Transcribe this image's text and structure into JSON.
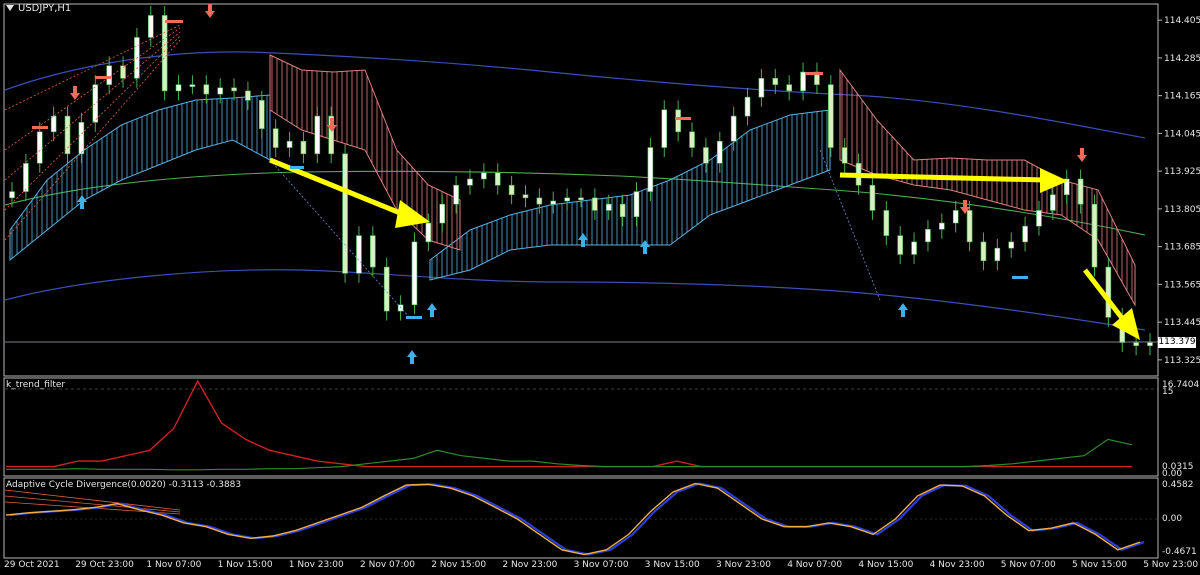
{
  "symbol": "USDJPY,H1",
  "current_price": "113.379",
  "chart_data": {
    "type": "line",
    "main_price_ticks": [
      "114.405",
      "114.285",
      "114.165",
      "114.045",
      "113.925",
      "113.805",
      "113.685",
      "113.565",
      "113.445",
      "113.325"
    ],
    "main_ylim": [
      113.28,
      114.45
    ],
    "time_labels": [
      "29 Oct 2021",
      "29 Oct 23:00",
      "1 Nov 07:00",
      "1 Nov 15:00",
      "1 Nov 23:00",
      "2 Nov 07:00",
      "2 Nov 15:00",
      "2 Nov 23:00",
      "3 Nov 07:00",
      "3 Nov 15:00",
      "3 Nov 23:00",
      "4 Nov 07:00",
      "4 Nov 15:00",
      "4 Nov 23:00",
      "5 Nov 07:00",
      "5 Nov 15:00",
      "5 Nov 23:00"
    ],
    "price_close": [
      113.86,
      113.95,
      114.05,
      114.1,
      113.98,
      114.08,
      114.2,
      114.26,
      114.22,
      114.35,
      114.42,
      114.18,
      114.2,
      114.2,
      114.17,
      114.19,
      114.18,
      114.15,
      114.06,
      114.0,
      114.02,
      113.98,
      114.1,
      113.98,
      113.6,
      113.72,
      113.62,
      113.48,
      113.5,
      113.7,
      113.76,
      113.82,
      113.88,
      113.9,
      113.92,
      113.88,
      113.85,
      113.84,
      113.82,
      113.83,
      113.84,
      113.84,
      113.8,
      113.82,
      113.78,
      113.86,
      114.0,
      114.12,
      114.05,
      114.0,
      113.95,
      114.02,
      114.1,
      114.16,
      114.22,
      114.2,
      114.18,
      114.24,
      114.2,
      114.0,
      113.95,
      113.88,
      113.8,
      113.72,
      113.66,
      113.7,
      113.74,
      113.76,
      113.8,
      113.7,
      113.64,
      113.68,
      113.7,
      113.75,
      113.8,
      113.85,
      113.9,
      113.82,
      113.62,
      113.46,
      113.38,
      113.37,
      113.38
    ],
    "series": [
      {
        "name": "k_trend_filter red",
        "values": [
          1,
          1,
          1,
          2,
          2,
          3,
          4,
          8,
          16.74,
          9,
          6,
          4,
          3,
          2,
          1.5,
          1,
          1,
          1,
          1,
          1,
          1,
          1,
          1,
          1,
          1,
          1,
          1,
          1,
          2,
          1,
          1,
          1,
          1,
          1,
          1,
          1,
          1,
          1,
          1,
          1,
          1,
          1,
          1,
          1,
          1,
          1,
          1,
          1
        ]
      },
      {
        "name": "k_trend_filter green",
        "values": [
          0.5,
          0.5,
          0.5,
          0.6,
          0.5,
          0.5,
          0.5,
          0.4,
          0.4,
          0.5,
          0.5,
          0.6,
          0.6,
          0.8,
          1,
          1.5,
          2,
          2.5,
          4,
          3,
          2.5,
          2,
          2,
          1.5,
          1.2,
          1,
          1,
          1,
          1,
          1,
          1,
          1,
          1,
          1,
          1,
          1,
          1,
          1,
          1,
          1,
          1,
          1.2,
          1.5,
          2,
          2.5,
          3,
          6,
          5
        ]
      }
    ],
    "sub1_title": "k_trend_filter",
    "sub1_ticks": [
      "16.7404",
      "15",
      "0.0315",
      "0.00"
    ],
    "sub2_title": "Adaptive Cycle Divergence(0.0020) -0.3113 -0.3883",
    "sub2_ticks": [
      "0.4582",
      "0.00",
      "-0.4671"
    ],
    "acd_yellow": [
      0.05,
      0.08,
      0.1,
      0.12,
      0.15,
      0.2,
      0.12,
      0.05,
      -0.05,
      -0.1,
      -0.2,
      -0.25,
      -0.22,
      -0.15,
      -0.05,
      0.05,
      0.15,
      0.3,
      0.44,
      0.45,
      0.4,
      0.3,
      0.15,
      0.0,
      -0.2,
      -0.4,
      -0.46,
      -0.4,
      -0.2,
      0.1,
      0.35,
      0.46,
      0.4,
      0.2,
      0.0,
      -0.1,
      -0.1,
      -0.05,
      -0.1,
      -0.2,
      0.0,
      0.3,
      0.44,
      0.43,
      0.3,
      0.05,
      -0.15,
      -0.12,
      -0.05,
      -0.2,
      -0.4,
      -0.3
    ]
  }
}
